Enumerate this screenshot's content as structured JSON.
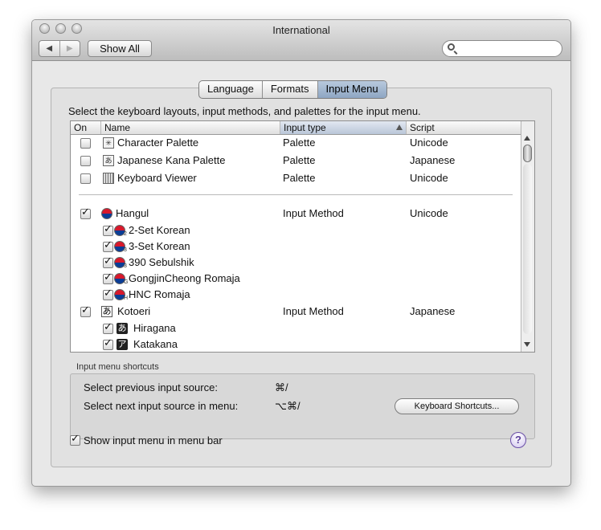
{
  "window": {
    "title": "International",
    "show_all_label": "Show All",
    "back_glyph": "◀",
    "forward_glyph": "▶",
    "search": {
      "placeholder": "",
      "value": ""
    }
  },
  "tabs": [
    {
      "label": "Language",
      "selected": false
    },
    {
      "label": "Formats",
      "selected": false
    },
    {
      "label": "Input Menu",
      "selected": true
    }
  ],
  "instruction": "Select the keyboard layouts, input methods, and palettes for the input menu.",
  "columns": {
    "on": "On",
    "name": "Name",
    "input_type": "Input type",
    "script": "Script"
  },
  "sorted_column": "input_type",
  "rows": [
    {
      "checked": false,
      "icon": "character-palette-icon",
      "name": "Character Palette",
      "type": "Palette",
      "script": "Unicode"
    },
    {
      "checked": false,
      "icon": "japanese-kana-palette-icon",
      "name": "Japanese Kana Palette",
      "type": "Palette",
      "script": "Japanese"
    },
    {
      "checked": false,
      "icon": "keyboard-viewer-icon",
      "name": "Keyboard Viewer",
      "type": "Palette",
      "script": "Unicode"
    },
    {
      "checked": true,
      "icon": "korean-flag-icon",
      "name": "Hangul",
      "type": "Input Method",
      "script": "Unicode"
    },
    {
      "checked": true,
      "icon": "korean-flag-icon",
      "sub": "2",
      "name": "2-Set Korean",
      "type": "",
      "script": ""
    },
    {
      "checked": true,
      "icon": "korean-flag-icon",
      "sub": "3",
      "name": "3-Set Korean",
      "type": "",
      "script": ""
    },
    {
      "checked": true,
      "icon": "korean-flag-icon",
      "sub": "3",
      "name": "390 Sebulshik",
      "type": "",
      "script": ""
    },
    {
      "checked": true,
      "icon": "korean-flag-icon",
      "sub": "G",
      "name": "GongjinCheong Romaja",
      "type": "",
      "script": ""
    },
    {
      "checked": true,
      "icon": "korean-flag-icon",
      "sub": "H",
      "name": "HNC Romaja",
      "type": "",
      "script": ""
    },
    {
      "checked": true,
      "icon": "kotoeri-icon",
      "name": "Kotoeri",
      "type": "Input Method",
      "script": "Japanese"
    },
    {
      "checked": true,
      "icon": "hiragana-icon",
      "name": "Hiragana",
      "type": "",
      "script": ""
    },
    {
      "checked": true,
      "icon": "katakana-icon",
      "name": "Katakana",
      "type": "",
      "script": ""
    }
  ],
  "shortcuts": {
    "label": "Input menu shortcuts",
    "previous_label": "Select previous input source:",
    "previous_keys": "⌘/",
    "next_label": "Select next input source in menu:",
    "next_keys": "⌥⌘/",
    "button_label": "Keyboard Shortcuts..."
  },
  "show_menu": {
    "label": "Show input menu in menu bar",
    "checked": true
  },
  "help_glyph": "?"
}
